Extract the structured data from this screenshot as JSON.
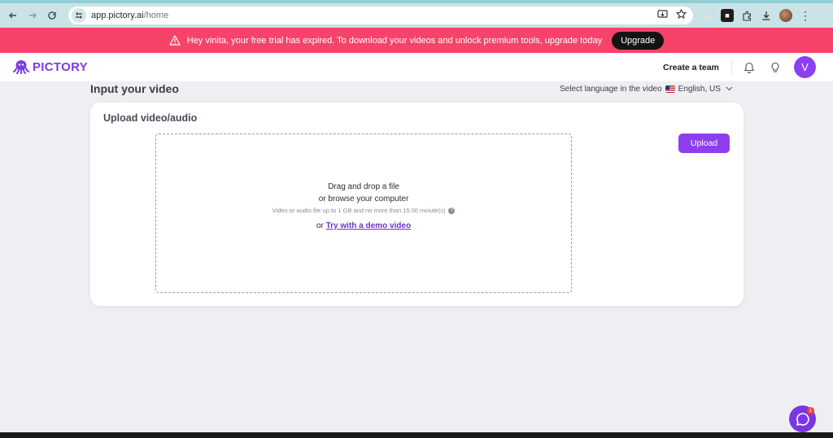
{
  "browser": {
    "url_host": "app.pictory.ai",
    "url_path": "/home"
  },
  "banner": {
    "message": "Hey vinita, your free trial has expired. To download your videos and unlock premium tools, upgrade today",
    "upgrade_label": "Upgrade",
    "bg_color": "#f7436a"
  },
  "header": {
    "logo_text": "PICTORY",
    "create_team_label": "Create a team",
    "avatar_initial": "V",
    "accent_color": "#8b3ff2"
  },
  "main": {
    "title": "Input your video",
    "language_label": "Select language in the video",
    "language_value": "English, US",
    "card": {
      "title": "Upload video/audio",
      "drag_text": "Drag and drop a file",
      "browse_text": "or browse your computer",
      "hint_text": "Video or audio file up to 1 GB and no more than 15.00 minute(s)",
      "demo_prefix": "or",
      "demo_link": "Try with a demo video",
      "upload_label": "Upload"
    }
  },
  "chat": {
    "badge_count": "1"
  }
}
